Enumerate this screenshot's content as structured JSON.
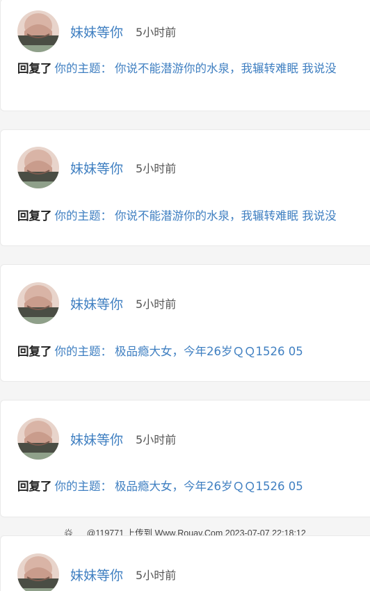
{
  "posts": [
    {
      "username": "妹妹等你",
      "time": "5小时前",
      "action": "回复了",
      "topic_label": "你的主题：",
      "topic_title": "你说不能潜游你的水泉，我辗转难眠 我说没"
    },
    {
      "username": "妹妹等你",
      "time": "5小时前",
      "action": "回复了",
      "topic_label": "你的主题：",
      "topic_title": "你说不能潜游你的水泉，我辗转难眠 我说没"
    },
    {
      "username": "妹妹等你",
      "time": "5小时前",
      "action": "回复了",
      "topic_label": "你的主题：",
      "topic_title": "极品瘾大女，今年26岁ＱＱ1526 05"
    },
    {
      "username": "妹妹等你",
      "time": "5小时前",
      "action": "回复了",
      "topic_label": "你的主题：",
      "topic_title": "极品瘾大女，今年26岁ＱＱ1526 05"
    },
    {
      "username": "妹妹等你",
      "time": "5小时前"
    }
  ],
  "watermark": {
    "logo": "焱",
    "text": "@119771 上传到 Www.Rouav.Com 2023-07-07 22:18:12"
  },
  "colors": {
    "link": "#3f7fc1",
    "text_dark": "#222222",
    "time": "#555555",
    "background": "#f5f5f5",
    "card": "#ffffff"
  }
}
